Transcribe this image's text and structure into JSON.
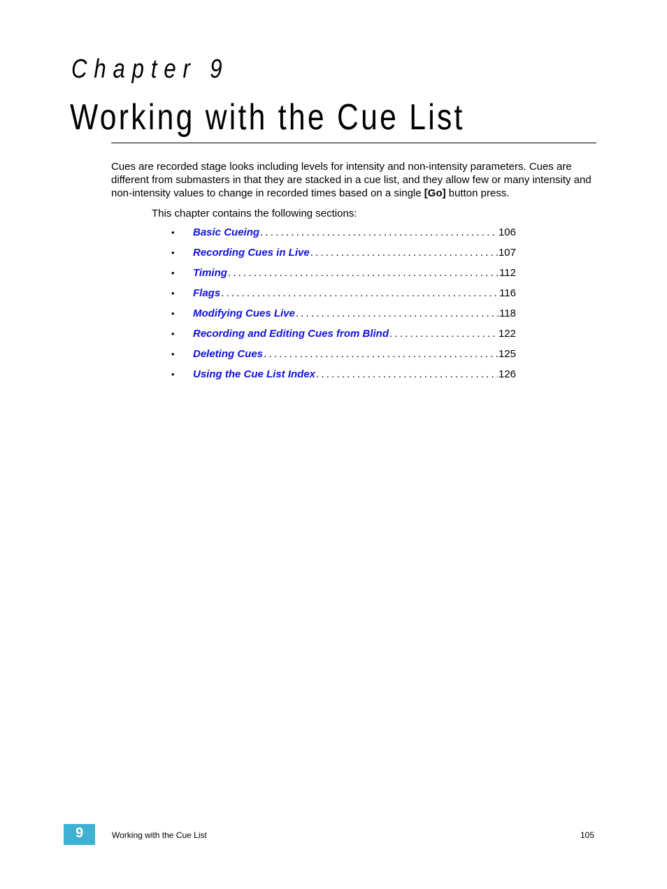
{
  "chapter": {
    "label": "Chapter 9",
    "title": "Working with the Cue List"
  },
  "intro": {
    "text_before": "Cues are recorded stage looks including levels for intensity and non-intensity parameters. Cues are different from submasters in that they are stacked in a cue list, and they allow few or many intensity and non-intensity values to change in recorded times based on a single ",
    "bold": "[Go]",
    "text_after": " button press."
  },
  "contains_text": "This chapter contains the following sections:",
  "toc": [
    {
      "bullet": "•",
      "label": "Basic Cueing",
      "page": "106"
    },
    {
      "bullet": "•",
      "label": "Recording Cues in Live",
      "page": "107"
    },
    {
      "bullet": "•",
      "label": "Timing",
      "page": "112"
    },
    {
      "bullet": "•",
      "label": "Flags",
      "page": "116"
    },
    {
      "bullet": "•",
      "label": "Modifying Cues Live",
      "page": "118"
    },
    {
      "bullet": "•",
      "label": "Recording and Editing Cues from Blind",
      "page": "122"
    },
    {
      "bullet": "•",
      "label": "Deleting Cues",
      "page": "125"
    },
    {
      "bullet": "•",
      "label": "Using the Cue List Index",
      "page": "126"
    }
  ],
  "footer": {
    "chapter_number": "9",
    "chapter_title": "Working with the Cue List",
    "page_number": "105",
    "badge_color": "#3fb1d3"
  },
  "colors": {
    "link": "#1111dd"
  }
}
